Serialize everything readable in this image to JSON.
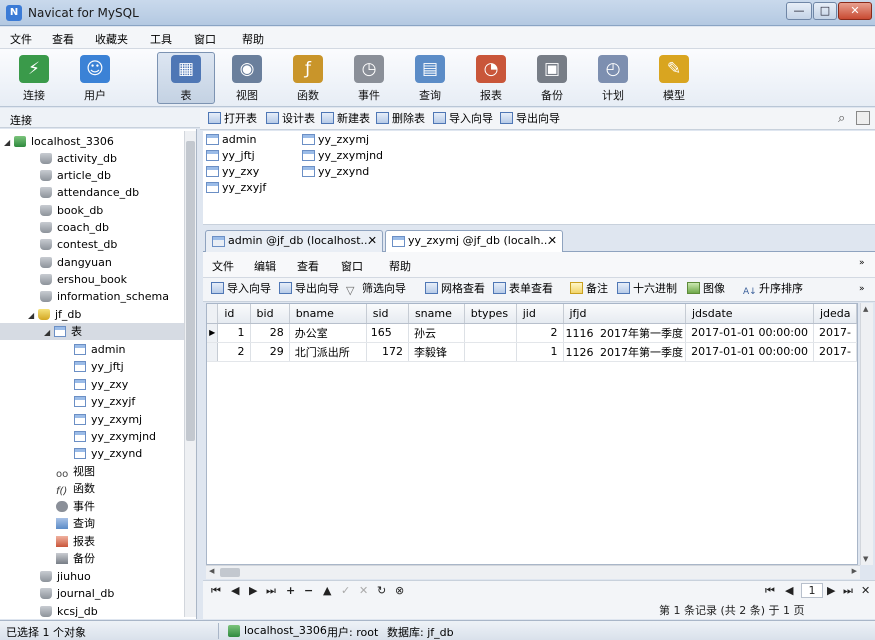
{
  "window": {
    "title": "Navicat for MySQL",
    "min": "—",
    "max": "□",
    "close": "✕"
  },
  "menu": [
    "文件",
    "查看",
    "收藏夹",
    "工具",
    "窗口",
    "帮助"
  ],
  "toolbar": [
    {
      "label": "连接",
      "icon": "connection-icon",
      "color": "#3a9a4a",
      "glyph": "⚡"
    },
    {
      "label": "用户",
      "icon": "user-icon",
      "color": "#3b82d6",
      "glyph": "☺"
    },
    {
      "label": "表",
      "icon": "table-icon",
      "color": "#4f77b5",
      "glyph": "▦"
    },
    {
      "label": "视图",
      "icon": "view-icon",
      "color": "#6a7f9c",
      "glyph": "◉"
    },
    {
      "label": "函数",
      "icon": "function-icon",
      "color": "#c9952a",
      "glyph": "ƒ"
    },
    {
      "label": "事件",
      "icon": "event-icon",
      "color": "#8a8f98",
      "glyph": "◷"
    },
    {
      "label": "查询",
      "icon": "query-icon",
      "color": "#5b8cc7",
      "glyph": "▤"
    },
    {
      "label": "报表",
      "icon": "report-icon",
      "color": "#c9563a",
      "glyph": "◔"
    },
    {
      "label": "备份",
      "icon": "backup-icon",
      "color": "#777d86",
      "glyph": "▣"
    },
    {
      "label": "计划",
      "icon": "schedule-icon",
      "color": "#7d8fb0",
      "glyph": "◴"
    },
    {
      "label": "模型",
      "icon": "model-icon",
      "color": "#d9a520",
      "glyph": "✎"
    }
  ],
  "sidebar": {
    "header": "连接",
    "connection": "localhost_3306",
    "dbs_before": [
      "activity_db",
      "article_db",
      "attendance_db",
      "book_db",
      "coach_db",
      "contest_db",
      "dangyuan",
      "ershou_book",
      "information_schema"
    ],
    "open_db": "jf_db",
    "tables_group": "表",
    "tables": [
      "admin",
      "yy_jftj",
      "yy_zxy",
      "yy_zxyjf",
      "yy_zxymj",
      "yy_zxymjnd",
      "yy_zxynd"
    ],
    "groups": [
      "视图",
      "函数",
      "事件",
      "查询",
      "报表",
      "备份"
    ],
    "dbs_after": [
      "jiuhuo",
      "journal_db",
      "kcsj_db"
    ]
  },
  "object_toolbar": [
    "打开表",
    "设计表",
    "新建表",
    "删除表",
    "导入向导",
    "导出向导"
  ],
  "object_list": [
    "admin",
    "yy_jftj",
    "yy_zxy",
    "yy_zxyjf",
    "yy_zxymj",
    "yy_zxymjnd",
    "yy_zxynd"
  ],
  "tabs": [
    {
      "label": "admin @jf_db (localhost..."
    },
    {
      "label": "yy_zxymj @jf_db (localh..."
    }
  ],
  "inner_menu": [
    "文件",
    "编辑",
    "查看",
    "窗口",
    "帮助"
  ],
  "inner_toolbar": [
    "导入向导",
    "导出向导",
    "筛选向导",
    "网格查看",
    "表单查看",
    "备注",
    "十六进制",
    "图像",
    "升序排序"
  ],
  "grid": {
    "columns": [
      "id",
      "bid",
      "bname",
      "sid",
      "sname",
      "btypes",
      "jid",
      "jfjd",
      "jdsdate",
      "jdeda"
    ],
    "rows": [
      [
        "1",
        "28",
        "办公室",
        "165",
        "孙云",
        "",
        "2",
        "1116",
        "2017年第一季度",
        "2017-01-01 00:00:00",
        "2017-"
      ],
      [
        "2",
        "29",
        "北门派出所",
        "172",
        "李毅锋",
        "",
        "1",
        "1126",
        "2017年第一季度",
        "2017-01-01 00:00:00",
        "2017-"
      ]
    ]
  },
  "nav": {
    "page": "1",
    "record_info": "第 1 条记录 (共 2 条) 于 1 页"
  },
  "status": {
    "selection": "已选择 1 个对象",
    "connection": "localhost_3306",
    "user": "用户: root",
    "database": "数据库: jf_db"
  }
}
